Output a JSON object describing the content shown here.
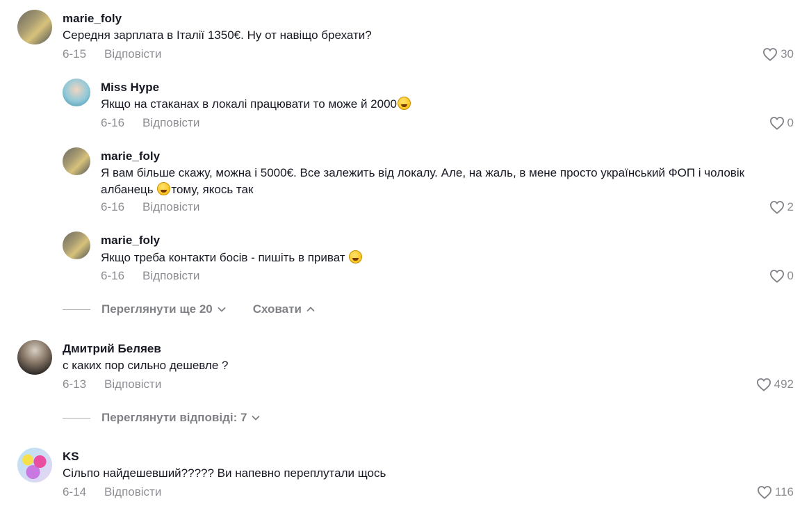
{
  "comments": [
    {
      "username": "marie_foly",
      "text": "Середня зарплата в Італії 1350€. Ну от навіщо брехати?",
      "date": "6-15",
      "reply_label": "Відповісти",
      "likes": "30",
      "replies": [
        {
          "username": "Miss Hype",
          "text": "Якщо на стаканах в локалі працювати то може й 2000",
          "date": "6-16",
          "reply_label": "Відповісти",
          "likes": "0"
        },
        {
          "username": "marie_foly",
          "text_line1": "Я вам більше скажу, можна і 5000€. Все залежить від локалу. Але, на жаль, в мене просто український ФОП і чоловік",
          "text_line2": "албанець",
          "text_line2_rest": "тому, якось так",
          "date": "6-16",
          "reply_label": "Відповісти",
          "likes": "2"
        },
        {
          "username": "marie_foly",
          "text": "Якщо треба контакти босів - пишіть в приват",
          "date": "6-16",
          "reply_label": "Відповісти",
          "likes": "0"
        }
      ],
      "view_more": "Переглянути ще 20",
      "hide": "Сховати"
    },
    {
      "username": "Дмитрий Беляев",
      "text": "с каких пор сильно дешевле ?",
      "date": "6-13",
      "reply_label": "Відповісти",
      "likes": "492",
      "view_replies": "Переглянути відповіді: 7"
    },
    {
      "username": "KS",
      "text": "Сільпо найдешевший????? Ви напевно переплутали щось",
      "date": "6-14",
      "reply_label": "Відповісти",
      "likes": "116"
    }
  ],
  "icons": {
    "like": "heart-outline-icon",
    "chevron_down": "chevron-down-icon",
    "chevron_up": "chevron-up-icon"
  }
}
